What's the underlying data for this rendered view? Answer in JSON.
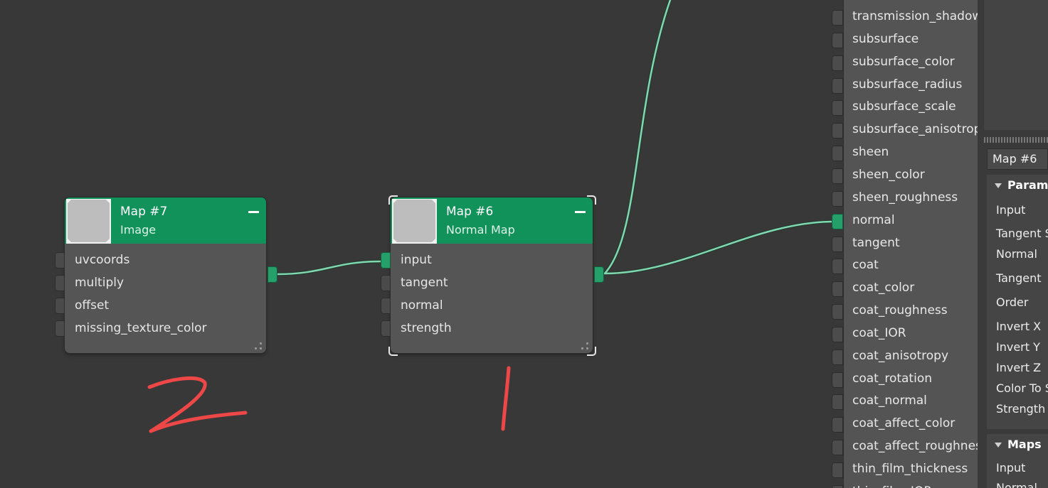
{
  "nodes": {
    "map7": {
      "name": "Map #7",
      "type": "Image",
      "inputs": [
        "uvcoords",
        "multiply",
        "offset",
        "missing_texture_color"
      ]
    },
    "map6": {
      "name": "Map #6",
      "type": "Normal Map",
      "inputs": [
        "input",
        "tangent",
        "normal",
        "strength"
      ]
    }
  },
  "material_inputs": [
    "transmission_shadow",
    "subsurface",
    "subsurface_color",
    "subsurface_radius",
    "subsurface_scale",
    "subsurface_anisotropy",
    "sheen",
    "sheen_color",
    "sheen_roughness",
    "normal",
    "tangent",
    "coat",
    "coat_color",
    "coat_roughness",
    "coat_IOR",
    "coat_anisotropy",
    "coat_rotation",
    "coat_normal",
    "coat_affect_color",
    "coat_affect_roughness",
    "thin_film_thickness",
    "thin_film_IOR"
  ],
  "panel": {
    "node_name": "Map #6",
    "parameters_title": "Parameters",
    "parameters": [
      "Input",
      "Tangent Space",
      "Normal",
      "Tangent",
      "Order",
      "Invert X",
      "Invert Y",
      "Invert Z",
      "Color To Space",
      "Strength"
    ],
    "maps_title": "Maps",
    "maps": [
      "Input",
      "Normal"
    ]
  },
  "annotations": {
    "node_map7_number": "2",
    "node_map6_number": "1"
  },
  "colors": {
    "background": "#383838",
    "node_header": "#10925a",
    "node_body": "#555555",
    "port_connected": "#26a06a",
    "wire": "#7fd8b0",
    "annotation": "#ee4747"
  }
}
